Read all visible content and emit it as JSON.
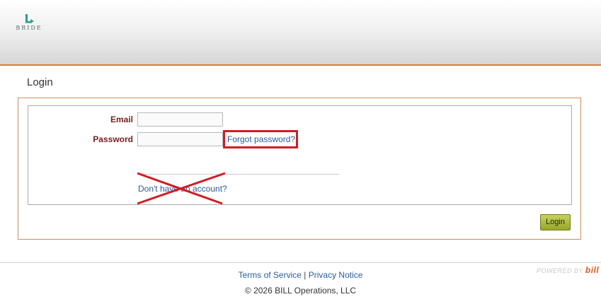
{
  "brand": {
    "logo_word": "BRIDE",
    "logo_subtitle": "",
    "accent_color": "#e07a2b"
  },
  "page": {
    "title": "Login"
  },
  "form": {
    "email_label": "Email",
    "email_value": "",
    "password_label": "Password",
    "password_value": "",
    "forgot_link": "Forgot password?",
    "signup_link": "Don't have an account?",
    "login_button": "Login"
  },
  "annotations": {
    "highlight_color": "#d11c24",
    "cross_color": "#d11c24"
  },
  "footer": {
    "terms_link": "Terms of Service",
    "separator": "|",
    "privacy_link": "Privacy Notice",
    "copyright": "© 2026 BILL Operations, LLC",
    "powered_by": "POWERED BY",
    "powered_brand": "bill"
  }
}
